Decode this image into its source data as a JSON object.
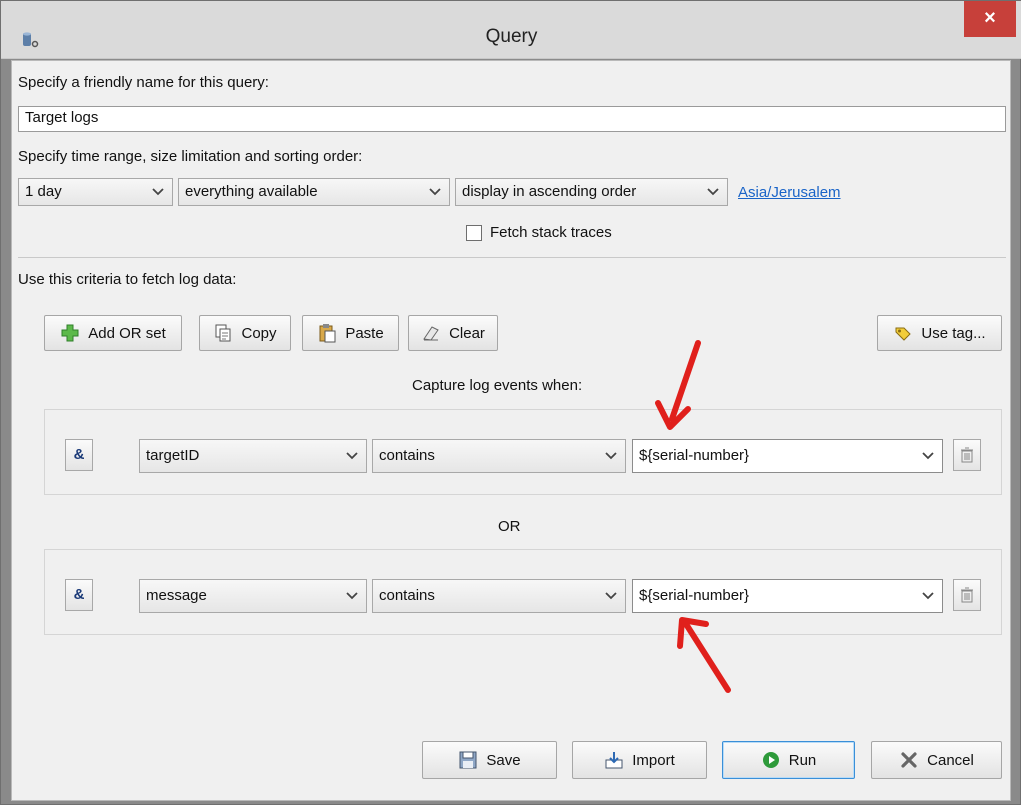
{
  "window": {
    "title": "Query",
    "close_glyph": "×"
  },
  "name_section": {
    "label": "Specify a friendly name for this query:",
    "value": "Target logs"
  },
  "range_section": {
    "label": "Specify time range, size limitation and sorting order:",
    "time_range": "1 day",
    "size_limit": "everything available",
    "sort_order": "display in ascending order",
    "timezone_link": "Asia/Jerusalem",
    "fetch_stack_traces_label": "Fetch stack traces",
    "fetch_stack_traces_checked": false
  },
  "criteria_section": {
    "label": "Use this criteria to fetch log data:",
    "toolbar": {
      "add_or_set": "Add OR set",
      "copy": "Copy",
      "paste": "Paste",
      "clear": "Clear",
      "use_tag": "Use tag..."
    },
    "capture_label": "Capture log events when:",
    "or_label": "OR",
    "conditions": [
      {
        "and_glyph": "&",
        "field": "targetID",
        "operator": "contains",
        "value": "${serial-number}"
      },
      {
        "and_glyph": "&",
        "field": "message",
        "operator": "contains",
        "value": "${serial-number}"
      }
    ]
  },
  "footer": {
    "save": "Save",
    "import": "Import",
    "run": "Run",
    "cancel": "Cancel"
  },
  "icons": {
    "app": "database-icon",
    "add": "plus-icon",
    "copy": "copy-icon",
    "paste": "paste-icon",
    "clear": "eraser-icon",
    "use_tag": "tag-icon",
    "save": "floppy-icon",
    "import": "import-icon",
    "run": "play-icon",
    "cancel": "x-icon",
    "delete": "trash-icon"
  },
  "colors": {
    "close_button": "#c7403a",
    "link": "#1a64c8",
    "annotation_arrow": "#e0201c",
    "run_icon": "#2e9a3a",
    "add_icon": "#4caf3c"
  }
}
